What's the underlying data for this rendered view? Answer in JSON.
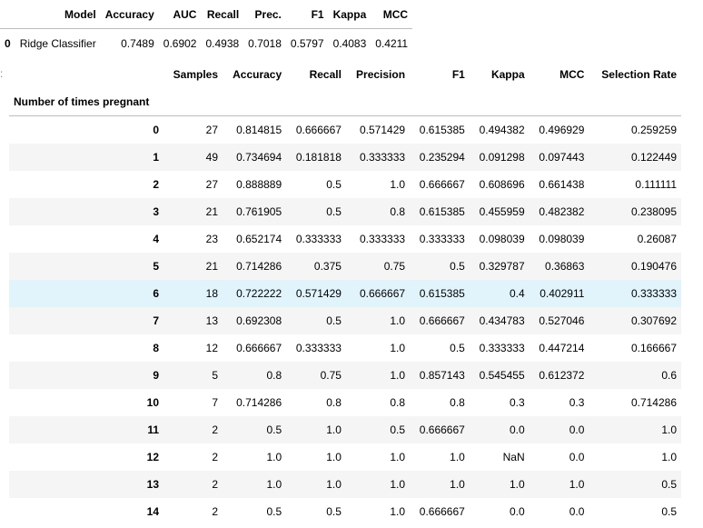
{
  "summary": {
    "columns": [
      "Model",
      "Accuracy",
      "AUC",
      "Recall",
      "Prec.",
      "F1",
      "Kappa",
      "MCC"
    ],
    "rows": [
      {
        "index": "0",
        "values": [
          "Ridge Classifier",
          "0.7489",
          "0.6902",
          "0.4938",
          "0.7018",
          "0.5797",
          "0.4083",
          "0.4211"
        ]
      }
    ]
  },
  "prompt": ":",
  "breakdown": {
    "columns": [
      "Samples",
      "Accuracy",
      "Recall",
      "Precision",
      "F1",
      "Kappa",
      "MCC",
      "Selection Rate"
    ],
    "index_name": "Number of times pregnant",
    "highlight_row": "6",
    "rows": [
      {
        "index": "0",
        "values": [
          "27",
          "0.814815",
          "0.666667",
          "0.571429",
          "0.615385",
          "0.494382",
          "0.496929",
          "0.259259"
        ]
      },
      {
        "index": "1",
        "values": [
          "49",
          "0.734694",
          "0.181818",
          "0.333333",
          "0.235294",
          "0.091298",
          "0.097443",
          "0.122449"
        ]
      },
      {
        "index": "2",
        "values": [
          "27",
          "0.888889",
          "0.5",
          "1.0",
          "0.666667",
          "0.608696",
          "0.661438",
          "0.111111"
        ]
      },
      {
        "index": "3",
        "values": [
          "21",
          "0.761905",
          "0.5",
          "0.8",
          "0.615385",
          "0.455959",
          "0.482382",
          "0.238095"
        ]
      },
      {
        "index": "4",
        "values": [
          "23",
          "0.652174",
          "0.333333",
          "0.333333",
          "0.333333",
          "0.098039",
          "0.098039",
          "0.26087"
        ]
      },
      {
        "index": "5",
        "values": [
          "21",
          "0.714286",
          "0.375",
          "0.75",
          "0.5",
          "0.329787",
          "0.36863",
          "0.190476"
        ]
      },
      {
        "index": "6",
        "values": [
          "18",
          "0.722222",
          "0.571429",
          "0.666667",
          "0.615385",
          "0.4",
          "0.402911",
          "0.333333"
        ]
      },
      {
        "index": "7",
        "values": [
          "13",
          "0.692308",
          "0.5",
          "1.0",
          "0.666667",
          "0.434783",
          "0.527046",
          "0.307692"
        ]
      },
      {
        "index": "8",
        "values": [
          "12",
          "0.666667",
          "0.333333",
          "1.0",
          "0.5",
          "0.333333",
          "0.447214",
          "0.166667"
        ]
      },
      {
        "index": "9",
        "values": [
          "5",
          "0.8",
          "0.75",
          "1.0",
          "0.857143",
          "0.545455",
          "0.612372",
          "0.6"
        ]
      },
      {
        "index": "10",
        "values": [
          "7",
          "0.714286",
          "0.8",
          "0.8",
          "0.8",
          "0.3",
          "0.3",
          "0.714286"
        ]
      },
      {
        "index": "11",
        "values": [
          "2",
          "0.5",
          "1.0",
          "0.5",
          "0.666667",
          "0.0",
          "0.0",
          "1.0"
        ]
      },
      {
        "index": "12",
        "values": [
          "2",
          "1.0",
          "1.0",
          "1.0",
          "1.0",
          "NaN",
          "0.0",
          "1.0"
        ]
      },
      {
        "index": "13",
        "values": [
          "2",
          "1.0",
          "1.0",
          "1.0",
          "1.0",
          "1.0",
          "1.0",
          "0.5"
        ]
      },
      {
        "index": "14",
        "values": [
          "2",
          "0.5",
          "0.5",
          "1.0",
          "0.666667",
          "0.0",
          "0.0",
          "0.5"
        ]
      }
    ]
  },
  "colors": {
    "stripe": "#f5f5f5",
    "highlight": "#e1f4fb",
    "border": "#bdbdbd"
  }
}
